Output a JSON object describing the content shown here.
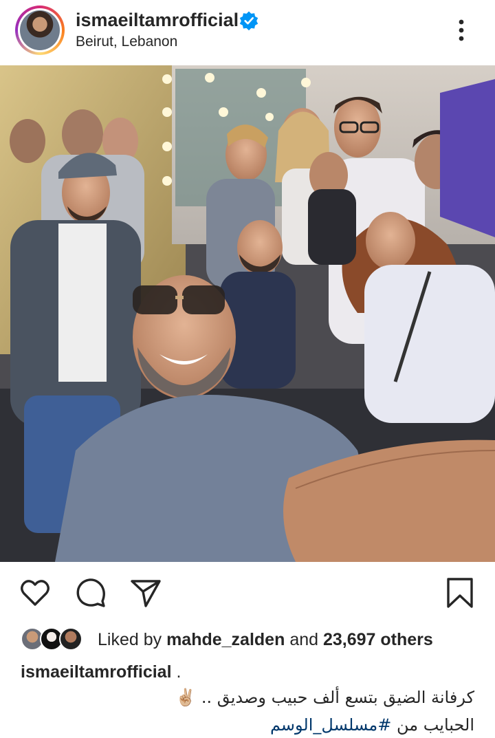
{
  "post": {
    "username": "ismaeiltamrofficial",
    "location": "Beirut, Lebanon",
    "verified": true
  },
  "likes": {
    "prefix": "Liked by",
    "first_liker": "mahde_zalden",
    "connector": "and",
    "others": "23,697 others"
  },
  "caption": {
    "username": "ismaeiltamrofficial",
    "after_username": ".",
    "line1": "كرفانة الضيق بتسع ألف حبيب وصديق ..",
    "line1_emoji": "✌🏼",
    "line2_prefix": "الحبايب من",
    "hashtag": "#مسلسل_الوسم"
  },
  "icons": {
    "more": "more-vertical-icon",
    "like": "heart-icon",
    "comment": "comment-icon",
    "share": "share-icon",
    "save": "bookmark-icon"
  },
  "colors": {
    "text": "#262626",
    "verified": "#0095f6",
    "hashtag": "#00376b"
  }
}
